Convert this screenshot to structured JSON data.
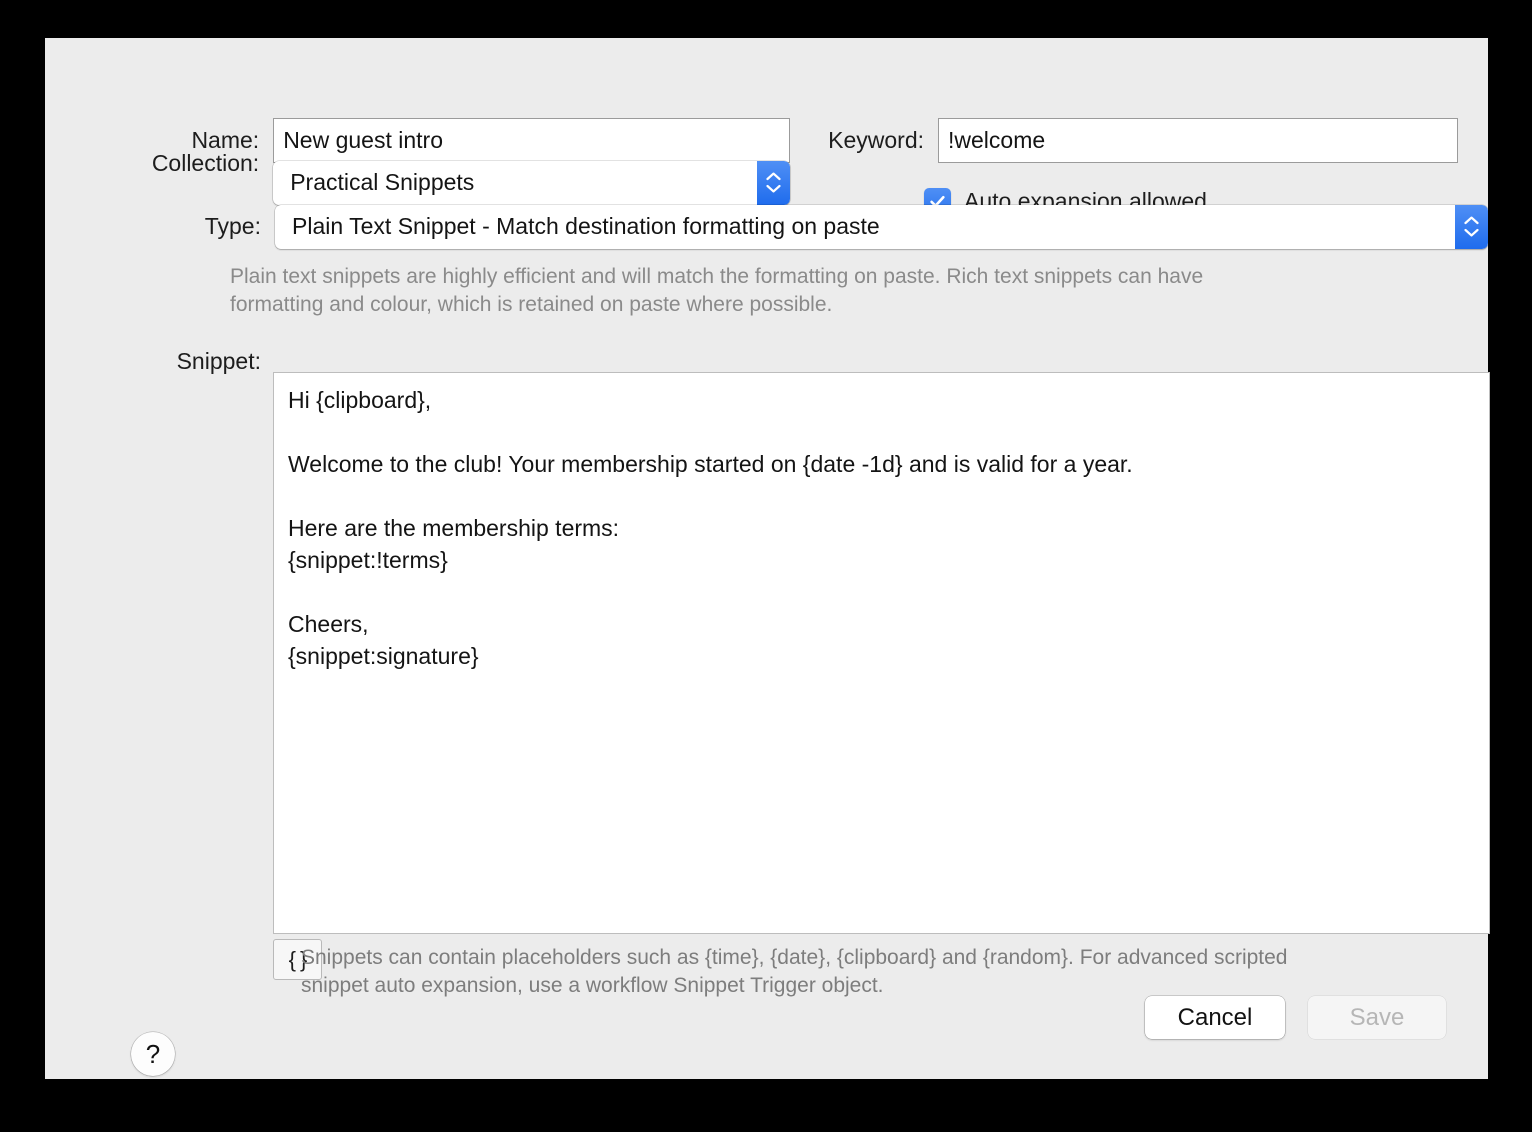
{
  "window": {
    "background": "#ececec"
  },
  "form": {
    "name": {
      "label": "Name:",
      "value": "New guest intro",
      "placeholder": ""
    },
    "keyword": {
      "label": "Keyword:",
      "value": "!welcome",
      "placeholder": ""
    },
    "collection": {
      "label": "Collection:",
      "value": "Practical Snippets"
    },
    "auto_expansion": {
      "label": "Auto expansion allowed",
      "checked": true
    },
    "type": {
      "label": "Type:",
      "value": "Plain Text Snippet - Match destination formatting on paste"
    },
    "type_description": "Plain text snippets are highly efficient and will match the formatting on paste. Rich text snippets can have formatting and colour, which is retained on paste where possible.",
    "snippet": {
      "label": "Snippet:",
      "value": "Hi {clipboard},\n\nWelcome to the club! Your membership started on {date -1d} and is valid for a year.\n\nHere are the membership terms:\n{snippet:!terms}\n\nCheers,\n{snippet:signature}"
    },
    "braces_button_label": "{ }",
    "placeholder_hint": "Snippets can contain placeholders such as {time}, {date}, {clipboard} and {random}. For advanced scripted snippet auto expansion, use a workflow Snippet Trigger object."
  },
  "footer": {
    "help_label": "?",
    "cancel_label": "Cancel",
    "save_label": "Save",
    "save_enabled": false
  },
  "colors": {
    "accent_blue": "#2c76ee",
    "window_bg": "#ececec",
    "field_border": "#9b9b9b",
    "muted_text": "#8a8a8a"
  }
}
